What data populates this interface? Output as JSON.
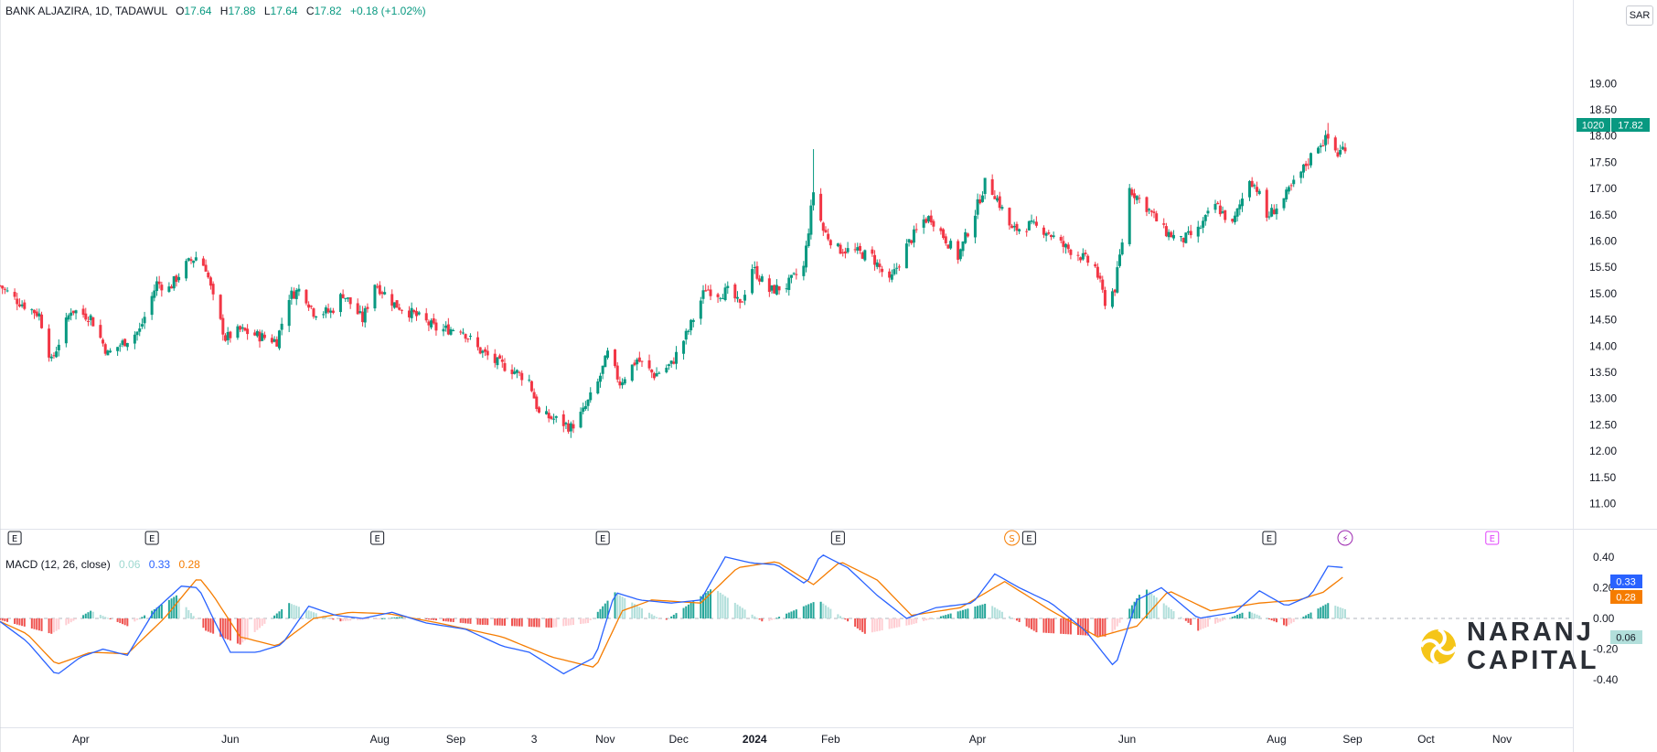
{
  "header": {
    "symbol": "BANK ALJAZIRA, 1D, TADAWUL",
    "open_label": "O",
    "open": "17.64",
    "high_label": "H",
    "high": "17.88",
    "low_label": "L",
    "low": "17.64",
    "close_label": "C",
    "close": "17.82",
    "change": "+0.18 (+1.02%)"
  },
  "currency": "SAR",
  "macd_header": {
    "title": "MACD (12, 26, close)",
    "hist": "0.06",
    "macd": "0.33",
    "signal": "0.28"
  },
  "price_tag": {
    "countdown": "1020",
    "price": "17.82"
  },
  "macd_tags": {
    "macd": "0.33",
    "signal": "0.28",
    "hist": "0.06"
  },
  "logo": {
    "line1": "NARANJ",
    "line2": "CAPITAL"
  },
  "colors": {
    "up": "#089981",
    "down": "#f23645",
    "macd": "#2962ff",
    "signal": "#f57c00",
    "hist_up": "#26a69a",
    "hist_up_light": "#b2dfdb",
    "hist_down": "#ef5350",
    "hist_down_light": "#ffcdd2",
    "logo_yellow": "#f5c518"
  },
  "event_markers": [
    {
      "glyph": "E",
      "type": "earnings",
      "date": "2023-03-05"
    },
    {
      "glyph": "E",
      "type": "earnings",
      "date": "2023-04-30"
    },
    {
      "glyph": "E",
      "type": "earnings",
      "date": "2023-07-31"
    },
    {
      "glyph": "E",
      "type": "earnings",
      "date": "2023-10-31"
    },
    {
      "glyph": "E",
      "type": "earnings",
      "date": "2024-02-04"
    },
    {
      "glyph": "S",
      "type": "split",
      "date": "2024-04-15"
    },
    {
      "glyph": "E",
      "type": "earnings",
      "date": "2024-04-22"
    },
    {
      "glyph": "E",
      "type": "earnings",
      "date": "2024-07-29"
    },
    {
      "glyph": "⚡",
      "type": "news",
      "date": "2024-08-29"
    },
    {
      "glyph": "E",
      "type": "earnings-upcoming",
      "date": "2024-10-28"
    }
  ],
  "chart_data": [
    {
      "type": "candlestick",
      "title": "BANK ALJAZIRA, 1D, TADAWUL",
      "price_axis": {
        "min": 11.0,
        "max": 19.0,
        "step": 0.5,
        "tick_labels": [
          "11.00",
          "11.50",
          "12.00",
          "12.50",
          "13.00",
          "13.50",
          "14.00",
          "14.50",
          "15.00",
          "15.50",
          "16.00",
          "16.50",
          "17.00",
          "17.50",
          "18.00",
          "18.50",
          "19.00"
        ]
      },
      "time_axis": {
        "labels": [
          {
            "text": "Apr",
            "date": "2023-04-01"
          },
          {
            "text": "Jun",
            "date": "2023-06-01"
          },
          {
            "text": "Aug",
            "date": "2023-08-01"
          },
          {
            "text": "Sep",
            "date": "2023-09-01"
          },
          {
            "text": "3",
            "date": "2023-10-03"
          },
          {
            "text": "Nov",
            "date": "2023-11-01"
          },
          {
            "text": "Dec",
            "date": "2023-12-01"
          },
          {
            "text": "2024",
            "date": "2024-01-01"
          },
          {
            "text": "Feb",
            "date": "2024-02-01"
          },
          {
            "text": "Apr",
            "date": "2024-04-01"
          },
          {
            "text": "Jun",
            "date": "2024-06-01"
          },
          {
            "text": "Aug",
            "date": "2024-08-01"
          },
          {
            "text": "Sep",
            "date": "2024-09-01"
          },
          {
            "text": "Oct",
            "date": "2024-10-01"
          },
          {
            "text": "Nov",
            "date": "2024-11-01"
          }
        ],
        "range": [
          "2023-02-27",
          "2024-11-15"
        ]
      },
      "close_path": [
        [
          "2023-02-27",
          15.15
        ],
        [
          "2023-03-05",
          14.9
        ],
        [
          "2023-03-15",
          14.6
        ],
        [
          "2023-03-20",
          13.7
        ],
        [
          "2023-03-28",
          14.7
        ],
        [
          "2023-04-05",
          14.55
        ],
        [
          "2023-04-12",
          13.85
        ],
        [
          "2023-04-25",
          14.3
        ],
        [
          "2023-05-02",
          15.2
        ],
        [
          "2023-05-07",
          15.1
        ],
        [
          "2023-05-14",
          15.55
        ],
        [
          "2023-05-18",
          15.7
        ],
        [
          "2023-05-22",
          15.5
        ],
        [
          "2023-05-25",
          14.9
        ],
        [
          "2023-05-30",
          14.15
        ],
        [
          "2023-06-05",
          14.3
        ],
        [
          "2023-06-12",
          14.2
        ],
        [
          "2023-06-20",
          14.1
        ],
        [
          "2023-06-25",
          14.95
        ],
        [
          "2023-06-30",
          15.1
        ],
        [
          "2023-07-05",
          14.65
        ],
        [
          "2023-07-12",
          14.65
        ],
        [
          "2023-07-17",
          15.0
        ],
        [
          "2023-07-25",
          14.5
        ],
        [
          "2023-07-30",
          15.2
        ],
        [
          "2023-08-07",
          14.8
        ],
        [
          "2023-08-15",
          14.6
        ],
        [
          "2023-08-25",
          14.3
        ],
        [
          "2023-09-03",
          14.35
        ],
        [
          "2023-09-10",
          13.95
        ],
        [
          "2023-09-17",
          13.7
        ],
        [
          "2023-09-24",
          13.55
        ],
        [
          "2023-10-01",
          13.35
        ],
        [
          "2023-10-05",
          12.7
        ],
        [
          "2023-10-12",
          12.6
        ],
        [
          "2023-10-18",
          12.45
        ],
        [
          "2023-10-23",
          12.75
        ],
        [
          "2023-10-29",
          13.3
        ],
        [
          "2023-11-02",
          13.85
        ],
        [
          "2023-11-07",
          13.3
        ],
        [
          "2023-11-14",
          13.75
        ],
        [
          "2023-11-21",
          13.45
        ],
        [
          "2023-11-28",
          13.65
        ],
        [
          "2023-12-05",
          14.3
        ],
        [
          "2023-12-12",
          15.1
        ],
        [
          "2023-12-17",
          15.0
        ],
        [
          "2023-12-22",
          15.05
        ],
        [
          "2023-12-26",
          14.75
        ],
        [
          "2023-12-31",
          15.5
        ],
        [
          "2024-01-07",
          15.05
        ],
        [
          "2024-01-14",
          15.15
        ],
        [
          "2024-01-21",
          15.5
        ],
        [
          "2024-01-25",
          16.95
        ],
        [
          "2024-01-29",
          16.2
        ],
        [
          "2024-02-04",
          15.85
        ],
        [
          "2024-02-11",
          15.8
        ],
        [
          "2024-02-18",
          15.7
        ],
        [
          "2024-02-25",
          15.2
        ],
        [
          "2024-03-03",
          15.9
        ],
        [
          "2024-03-10",
          16.4
        ],
        [
          "2024-03-13",
          16.45
        ],
        [
          "2024-03-18",
          16.1
        ],
        [
          "2024-03-24",
          15.7
        ],
        [
          "2024-03-31",
          16.55
        ],
        [
          "2024-04-04",
          17.1
        ],
        [
          "2024-04-08",
          16.9
        ],
        [
          "2024-04-15",
          16.2
        ],
        [
          "2024-04-22",
          16.3
        ],
        [
          "2024-04-29",
          16.2
        ],
        [
          "2024-05-06",
          15.9
        ],
        [
          "2024-05-12",
          15.75
        ],
        [
          "2024-05-19",
          15.5
        ],
        [
          "2024-05-23",
          14.85
        ],
        [
          "2024-05-27",
          15.1
        ],
        [
          "2024-05-30",
          16.0
        ],
        [
          "2024-06-02",
          17.0
        ],
        [
          "2024-06-09",
          16.65
        ],
        [
          "2024-06-16",
          16.2
        ],
        [
          "2024-06-23",
          16.0
        ],
        [
          "2024-06-30",
          16.2
        ],
        [
          "2024-07-07",
          16.7
        ],
        [
          "2024-07-14",
          16.3
        ],
        [
          "2024-07-21",
          17.2
        ],
        [
          "2024-07-24",
          17.0
        ],
        [
          "2024-07-28",
          16.45
        ],
        [
          "2024-08-04",
          16.8
        ],
        [
          "2024-08-11",
          17.3
        ],
        [
          "2024-08-18",
          17.85
        ],
        [
          "2024-08-22",
          17.95
        ],
        [
          "2024-08-26",
          17.65
        ],
        [
          "2024-08-29",
          17.82
        ]
      ],
      "spikes": [
        [
          "2024-01-25",
          17.75
        ],
        [
          "2024-05-23",
          14.7
        ],
        [
          "2024-08-22",
          18.25
        ],
        [
          "2023-10-18",
          12.25
        ]
      ]
    },
    {
      "type": "macd",
      "title": "MACD (12, 26, close)",
      "y_axis": {
        "min": -0.4,
        "max": 0.4,
        "tick_labels": [
          "-0.40",
          "-0.20",
          "0.00",
          "0.20",
          "0.40"
        ],
        "tick_values": [
          -0.4,
          -0.2,
          0.0,
          0.2,
          0.4
        ]
      },
      "macd_line": [
        [
          "2023-02-27",
          -0.02
        ],
        [
          "2023-03-10",
          -0.15
        ],
        [
          "2023-03-22",
          -0.37
        ],
        [
          "2023-04-01",
          -0.25
        ],
        [
          "2023-04-10",
          -0.2
        ],
        [
          "2023-04-20",
          -0.24
        ],
        [
          "2023-05-01",
          0.05
        ],
        [
          "2023-05-12",
          0.21
        ],
        [
          "2023-05-19",
          0.2
        ],
        [
          "2023-05-25",
          0.0
        ],
        [
          "2023-06-01",
          -0.22
        ],
        [
          "2023-06-12",
          -0.22
        ],
        [
          "2023-06-22",
          -0.17
        ],
        [
          "2023-07-03",
          0.08
        ],
        [
          "2023-07-14",
          0.02
        ],
        [
          "2023-07-25",
          0.0
        ],
        [
          "2023-08-06",
          0.04
        ],
        [
          "2023-08-20",
          -0.03
        ],
        [
          "2023-09-05",
          -0.07
        ],
        [
          "2023-09-20",
          -0.18
        ],
        [
          "2023-10-01",
          -0.22
        ],
        [
          "2023-10-15",
          -0.36
        ],
        [
          "2023-10-28",
          -0.25
        ],
        [
          "2023-11-05",
          0.17
        ],
        [
          "2023-11-15",
          0.12
        ],
        [
          "2023-11-28",
          0.1
        ],
        [
          "2023-12-10",
          0.12
        ],
        [
          "2023-12-20",
          0.4
        ],
        [
          "2023-12-31",
          0.36
        ],
        [
          "2024-01-10",
          0.35
        ],
        [
          "2024-01-22",
          0.22
        ],
        [
          "2024-01-28",
          0.42
        ],
        [
          "2024-02-08",
          0.33
        ],
        [
          "2024-02-20",
          0.15
        ],
        [
          "2024-03-03",
          0.0
        ],
        [
          "2024-03-15",
          0.07
        ],
        [
          "2024-03-30",
          0.1
        ],
        [
          "2024-04-08",
          0.29
        ],
        [
          "2024-04-18",
          0.2
        ],
        [
          "2024-05-01",
          0.1
        ],
        [
          "2024-05-15",
          -0.08
        ],
        [
          "2024-05-27",
          -0.32
        ],
        [
          "2024-06-05",
          0.12
        ],
        [
          "2024-06-15",
          0.2
        ],
        [
          "2024-06-30",
          0.0
        ],
        [
          "2024-07-15",
          0.04
        ],
        [
          "2024-07-25",
          0.18
        ],
        [
          "2024-08-05",
          0.08
        ],
        [
          "2024-08-15",
          0.15
        ],
        [
          "2024-08-22",
          0.34
        ],
        [
          "2024-08-29",
          0.33
        ]
      ],
      "signal_line": [
        [
          "2023-02-27",
          -0.02
        ],
        [
          "2023-03-10",
          -0.1
        ],
        [
          "2023-03-22",
          -0.3
        ],
        [
          "2023-04-05",
          -0.22
        ],
        [
          "2023-04-20",
          -0.23
        ],
        [
          "2023-05-05",
          0.0
        ],
        [
          "2023-05-19",
          0.27
        ],
        [
          "2023-05-25",
          0.15
        ],
        [
          "2023-06-05",
          -0.12
        ],
        [
          "2023-06-20",
          -0.18
        ],
        [
          "2023-07-05",
          0.0
        ],
        [
          "2023-07-20",
          0.04
        ],
        [
          "2023-08-05",
          0.03
        ],
        [
          "2023-08-25",
          -0.03
        ],
        [
          "2023-09-20",
          -0.12
        ],
        [
          "2023-10-10",
          -0.25
        ],
        [
          "2023-10-28",
          -0.32
        ],
        [
          "2023-11-08",
          0.05
        ],
        [
          "2023-11-20",
          0.12
        ],
        [
          "2023-12-10",
          0.1
        ],
        [
          "2023-12-25",
          0.33
        ],
        [
          "2024-01-10",
          0.37
        ],
        [
          "2024-01-25",
          0.22
        ],
        [
          "2024-02-05",
          0.37
        ],
        [
          "2024-02-20",
          0.25
        ],
        [
          "2024-03-05",
          0.02
        ],
        [
          "2024-03-25",
          0.07
        ],
        [
          "2024-04-12",
          0.24
        ],
        [
          "2024-05-01",
          0.05
        ],
        [
          "2024-05-20",
          -0.12
        ],
        [
          "2024-06-05",
          -0.05
        ],
        [
          "2024-06-18",
          0.18
        ],
        [
          "2024-07-05",
          0.05
        ],
        [
          "2024-07-25",
          0.1
        ],
        [
          "2024-08-10",
          0.12
        ],
        [
          "2024-08-20",
          0.17
        ],
        [
          "2024-08-29",
          0.28
        ]
      ],
      "histogram_envelope": [
        [
          "2023-02-27",
          -0.01
        ],
        [
          "2023-03-20",
          -0.1
        ],
        [
          "2023-04-05",
          0.05
        ],
        [
          "2023-04-20",
          -0.05
        ],
        [
          "2023-05-10",
          0.15
        ],
        [
          "2023-05-22",
          -0.08
        ],
        [
          "2023-06-05",
          -0.17
        ],
        [
          "2023-06-25",
          0.1
        ],
        [
          "2023-07-15",
          -0.02
        ],
        [
          "2023-08-10",
          0.01
        ],
        [
          "2023-09-10",
          -0.04
        ],
        [
          "2023-10-10",
          -0.06
        ],
        [
          "2023-10-25",
          -0.03
        ],
        [
          "2023-11-05",
          0.17
        ],
        [
          "2023-11-25",
          -0.02
        ],
        [
          "2023-12-15",
          0.2
        ],
        [
          "2024-01-05",
          -0.03
        ],
        [
          "2024-01-27",
          0.12
        ],
        [
          "2024-02-15",
          -0.1
        ],
        [
          "2024-03-05",
          -0.04
        ],
        [
          "2024-04-05",
          0.1
        ],
        [
          "2024-04-25",
          -0.09
        ],
        [
          "2024-05-25",
          -0.12
        ],
        [
          "2024-06-08",
          0.2
        ],
        [
          "2024-06-30",
          -0.08
        ],
        [
          "2024-07-20",
          0.05
        ],
        [
          "2024-08-05",
          -0.05
        ],
        [
          "2024-08-22",
          0.1
        ],
        [
          "2024-08-29",
          0.06
        ]
      ]
    }
  ]
}
